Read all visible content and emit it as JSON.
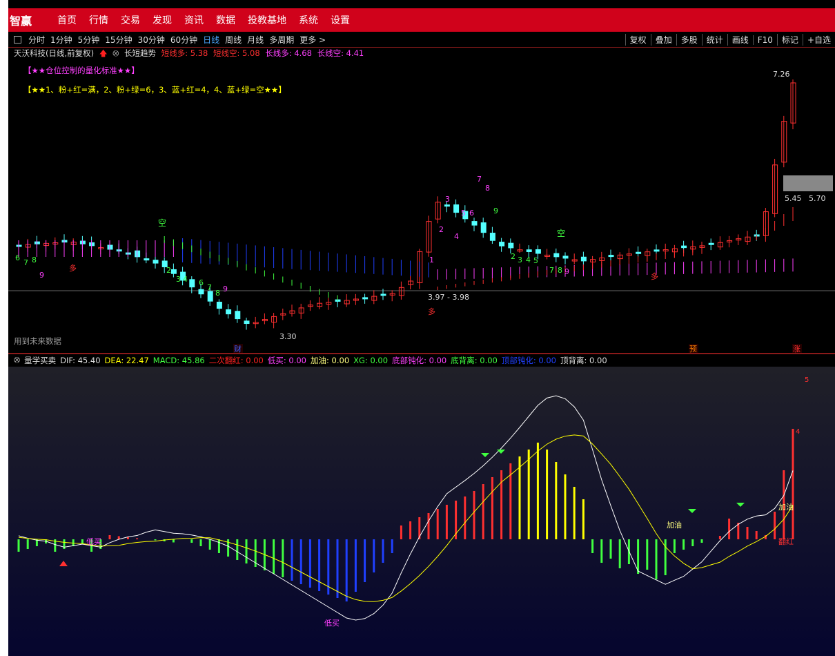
{
  "app": {
    "brand": "智赢"
  },
  "menu": [
    "首页",
    "行情",
    "交易",
    "发现",
    "资讯",
    "数据",
    "投教基地",
    "系统",
    "设置"
  ],
  "periods": [
    "分时",
    "1分钟",
    "5分钟",
    "15分钟",
    "30分钟",
    "60分钟",
    "日线",
    "周线",
    "月线",
    "多周期",
    "更多 >"
  ],
  "active_period": "日线",
  "tools": [
    "复权",
    "叠加",
    "多股",
    "统计",
    "画线",
    "F10",
    "标记",
    "+自选"
  ],
  "stock": {
    "title": "天沃科技(日线,前复权)",
    "indicator": "长短趋势",
    "short_long_label": "短线多: 5.38",
    "short_short_label": "短线空: 5.08",
    "long_long_label": "长线多: 4.68",
    "long_short_label": "长线空: 4.41"
  },
  "notes": {
    "line1": "【★★仓位控制的量化标准★★】",
    "line2": "【★★1、粉+红=满，2、粉+绿=6，3、蓝+红=4，4、蓝+绿=空★★】"
  },
  "prices": {
    "high": "7.26",
    "mid_left": "5.45",
    "mid_right": "5.70",
    "range": "3.97 - 3.98",
    "low": "3.30"
  },
  "future_data": "用到未来数据",
  "markers": {
    "cai": "财",
    "yu": "预",
    "zhang": "涨",
    "kong": "空",
    "duo": "多"
  },
  "macd": {
    "name": "量学买卖",
    "dif": "DIF: 45.40",
    "dea": "DEA: 22.47",
    "macd": "MACD: 45.86",
    "erci": "二次翻红: 0.00",
    "dimai": "低买: 0.00",
    "jiayou": "加油: 0.00",
    "xg": "XG: 0.00",
    "dibu": "底部钝化: 0.00",
    "dibei": "底背离: 0.00",
    "dingbu": "顶部钝化: 0.00",
    "dingbei": "顶背离: 0.00"
  },
  "macd_labels": {
    "dimai": "低买",
    "jiayou": "加油",
    "fanhong": "翻红"
  },
  "colors": {
    "up": "#ff3030",
    "down": "#54ffff",
    "pink": "#ff40ff",
    "blue": "#2040ff",
    "green": "#40ff40",
    "yellow": "#ffff00",
    "brand": "#d0021b"
  }
}
